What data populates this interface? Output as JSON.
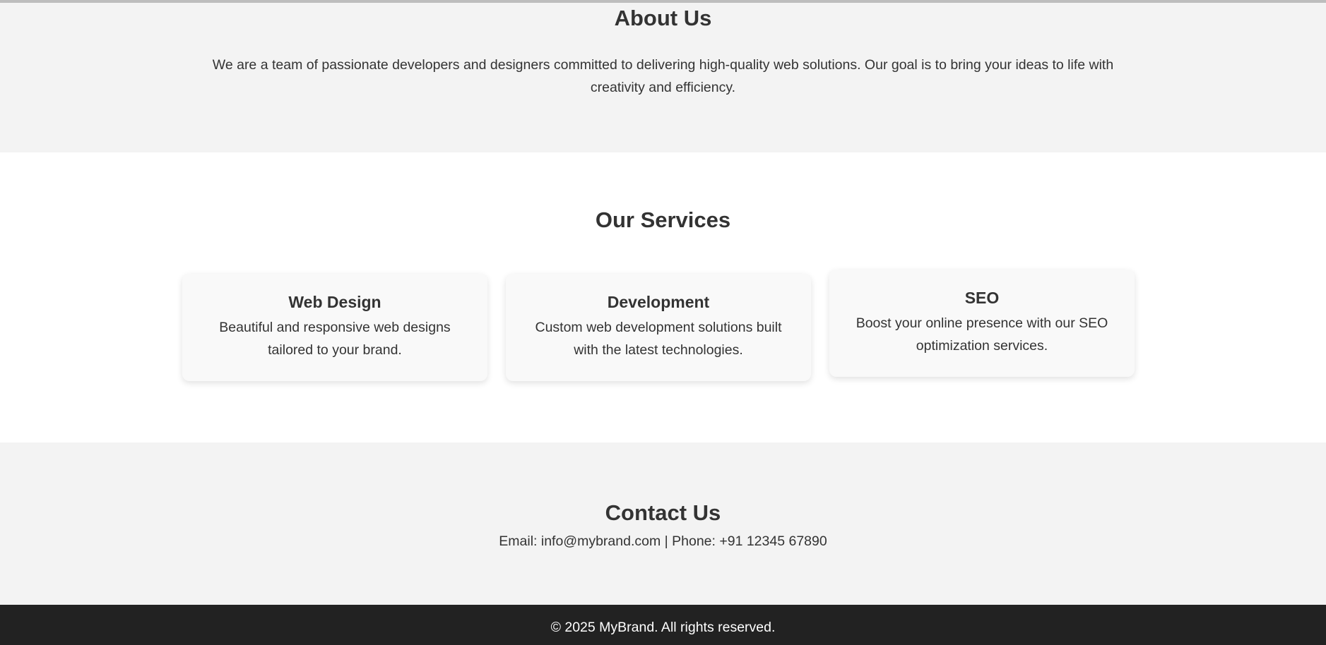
{
  "about": {
    "title": "About Us",
    "text": "We are a team of passionate developers and designers committed to delivering high-quality web solutions. Our goal is to bring your ideas to life with creativity and efficiency."
  },
  "services": {
    "title": "Our Services",
    "items": [
      {
        "title": "Web Design",
        "description": "Beautiful and responsive web designs tailored to your brand."
      },
      {
        "title": "Development",
        "description": "Custom web development solutions built with the latest technologies."
      },
      {
        "title": "SEO",
        "description": "Boost your online presence with our SEO optimization services."
      }
    ]
  },
  "contact": {
    "title": "Contact Us",
    "details": "Email: info@mybrand.com | Phone: +91 12345 67890"
  },
  "footer": {
    "copyright": "© 2025 MyBrand. All rights reserved."
  },
  "colors": {
    "section_gray": "#f3f3f3",
    "card_background": "#f9f9f9",
    "footer_background": "#222222",
    "text": "#333333"
  }
}
